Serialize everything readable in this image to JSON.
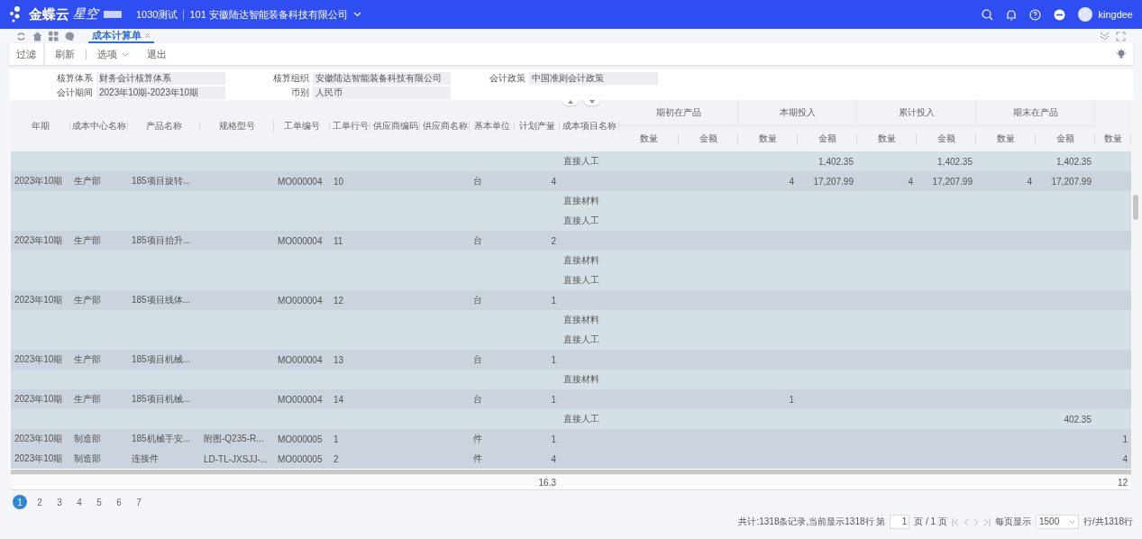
{
  "top_bar": {
    "brand": "金蝶云",
    "product": "星空",
    "tenant": "1030测试",
    "organization": "101 安徽陆达智能装备科技有限公司",
    "user": "kingdee"
  },
  "tabs": [
    {
      "label": "成本计算单",
      "selected": true
    }
  ],
  "toolbar": {
    "filter": "过滤",
    "refresh": "刷新",
    "options": "选项",
    "exit": "退出"
  },
  "filters": [
    {
      "label": "核算体系",
      "value": "财务会计核算体系"
    },
    {
      "label": "核算组织",
      "value": "安徽陆达智能装备科技有限公司"
    },
    {
      "label": "会计政策",
      "value": "中国准则会计政策"
    },
    {
      "label": "会计期间",
      "value": "2023年10期-2023年10期"
    },
    {
      "label": "币别",
      "value": "人民币"
    }
  ],
  "table": {
    "columns": [
      "年期",
      "成本中心名称",
      "产品名称",
      "规格型号",
      "工单编号",
      "工单行号",
      "供应商编码",
      "供应商名称",
      "基本单位",
      "计划产量",
      "成本项目名称"
    ],
    "groups": [
      {
        "label": "期初在产品",
        "columns": [
          "数量",
          "金额"
        ]
      },
      {
        "label": "本期投入",
        "columns": [
          "数量",
          "金额"
        ]
      },
      {
        "label": "累计投入",
        "columns": [
          "数量",
          "金额"
        ]
      },
      {
        "label": "期末在产品",
        "columns": [
          "数量",
          "金额"
        ]
      },
      {
        "columns": [
          "数量"
        ]
      }
    ],
    "rows": [
      {
        "kind": "sub",
        "cost_item": "直接人工",
        "current_amount": "1,402.35",
        "cumulative_amount": "1,402.35",
        "closing_amount": "1,402.35"
      },
      {
        "kind": "main",
        "period": "2023年10期",
        "cost_center": "生产部",
        "product": "185项目旋转...",
        "order_no": "MO000004",
        "order_line": "10",
        "unit": "台",
        "planned_qty": "4",
        "current_qty": "4",
        "current_amount": "17,207.99",
        "cumulative_qty": "4",
        "cumulative_amount": "17,207.99",
        "closing_qty": "4",
        "closing_amount": "17,207.99"
      },
      {
        "kind": "sub",
        "cost_item": "直接材料"
      },
      {
        "kind": "sub",
        "cost_item": "直接人工"
      },
      {
        "kind": "main",
        "period": "2023年10期",
        "cost_center": "生产部",
        "product": "185项目抬升...",
        "order_no": "MO000004",
        "order_line": "11",
        "unit": "台",
        "planned_qty": "2"
      },
      {
        "kind": "sub",
        "cost_item": "直接材料"
      },
      {
        "kind": "sub",
        "cost_item": "直接人工"
      },
      {
        "kind": "main",
        "period": "2023年10期",
        "cost_center": "生产部",
        "product": "185项目线体...",
        "order_no": "MO000004",
        "order_line": "12",
        "unit": "台",
        "planned_qty": "1"
      },
      {
        "kind": "sub",
        "cost_item": "直接材料"
      },
      {
        "kind": "sub",
        "cost_item": "直接人工"
      },
      {
        "kind": "main",
        "period": "2023年10期",
        "cost_center": "生产部",
        "product": "185项目机械...",
        "order_no": "MO000004",
        "order_line": "13",
        "unit": "台",
        "planned_qty": "1"
      },
      {
        "kind": "sub",
        "cost_item": "直接材料"
      },
      {
        "kind": "main",
        "period": "2023年10期",
        "cost_center": "生产部",
        "product": "185项目机械...",
        "order_no": "MO000004",
        "order_line": "14",
        "unit": "台",
        "planned_qty": "1",
        "current_qty": "1"
      },
      {
        "kind": "sub",
        "cost_item": "直接人工",
        "closing_amount": "402.35"
      },
      {
        "kind": "main",
        "period": "2023年10期",
        "cost_center": "制造部",
        "product": "185机械手安...",
        "spec": "附图-Q235-R...",
        "order_no": "MO000005",
        "order_line": "1",
        "unit": "件",
        "planned_qty": "1",
        "column_20_qty": "1"
      },
      {
        "kind": "main",
        "period": "2023年10期",
        "cost_center": "制造部",
        "product": "连接件",
        "spec": "LD-TL-JXSJJ-...",
        "order_no": "MO000005",
        "order_line": "2",
        "unit": "件",
        "planned_qty": "4",
        "column_20_qty": "4"
      }
    ],
    "totals": {
      "planned_qty": "16.3",
      "column_20_qty": "12"
    }
  },
  "pages": [
    {
      "label": "1",
      "selected": true
    },
    {
      "label": "2",
      "selected": false
    },
    {
      "label": "3",
      "selected": false
    },
    {
      "label": "4",
      "selected": false
    },
    {
      "label": "5",
      "selected": false
    },
    {
      "label": "6",
      "selected": false
    },
    {
      "label": "7",
      "selected": false
    }
  ],
  "status": {
    "summary": "共计:1318条记录,当前显示1318行 第",
    "page": "1",
    "page_of": "页 / 1 页",
    "per_page_label": "每页显示",
    "per_page": "1500",
    "total_rows": "行/共1318行"
  }
}
